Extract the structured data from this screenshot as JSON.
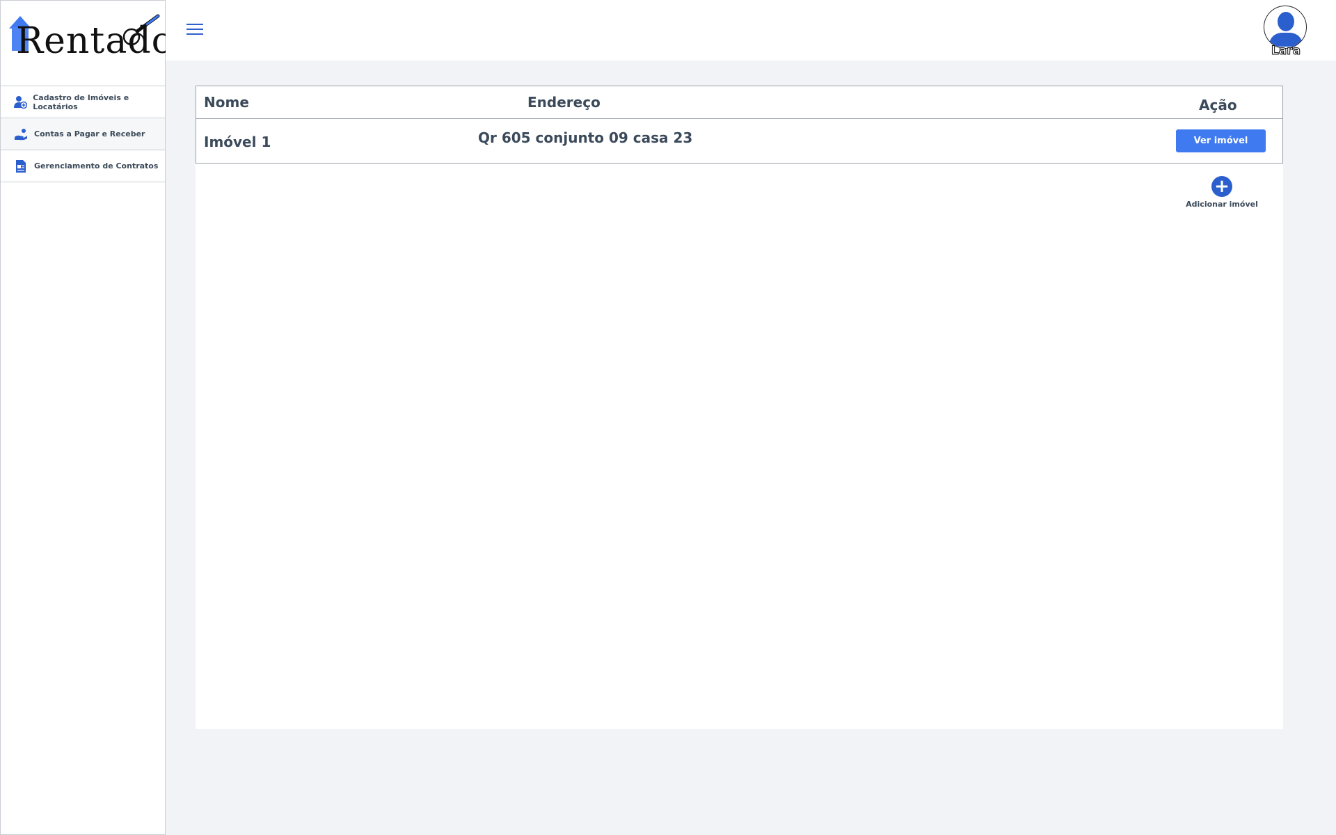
{
  "brand": {
    "logo_text": "Rentado",
    "accent": "#2f5fd0"
  },
  "sidebar": {
    "items": [
      {
        "label": "Cadastro de Imóveis e Locatários",
        "icon": "user-plus-icon"
      },
      {
        "label": "Contas a Pagar e Receber",
        "icon": "hand-money-icon"
      },
      {
        "label": "Gerenciamento de Contratos",
        "icon": "contract-document-icon"
      }
    ]
  },
  "header": {
    "menu_icon": "hamburger-icon",
    "user_name": "Lara"
  },
  "table": {
    "columns": [
      "Nome",
      "Endereço",
      "Ação"
    ],
    "rows": [
      {
        "nome": "Imóvel 1",
        "endereco": "Qr 605 conjunto 09 casa 23",
        "action_label": "Ver imóvel"
      }
    ]
  },
  "add": {
    "label": "Adicionar imóvel",
    "icon": "plus-circle-icon"
  },
  "colors": {
    "button": "#3f7af0",
    "add_circle": "#2c5fce",
    "background": "#f1f3f6"
  }
}
